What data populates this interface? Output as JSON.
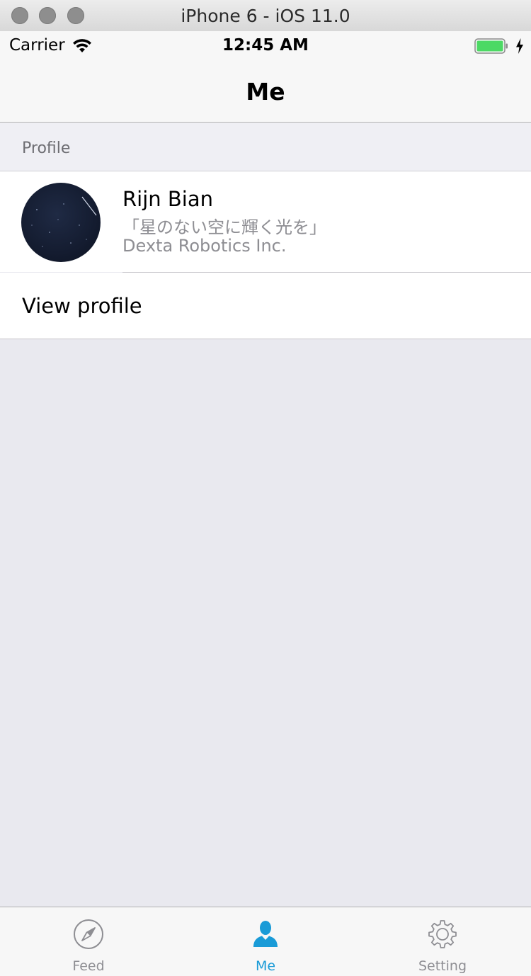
{
  "simulator": {
    "title": "iPhone 6 - iOS 11.0"
  },
  "status_bar": {
    "carrier": "Carrier",
    "time": "12:45 AM",
    "battery_color": "#4cd964"
  },
  "nav": {
    "title": "Me"
  },
  "profile_section": {
    "header": "Profile",
    "name": "Rijn Bian",
    "motto": "「星のない空に輝く光を」",
    "company": "Dexta Robotics Inc.",
    "view_profile_label": "View profile"
  },
  "tabbar": {
    "active_color": "#1a9bd7",
    "items": [
      {
        "label": "Feed",
        "icon": "compass-icon"
      },
      {
        "label": "Me",
        "icon": "person-icon"
      },
      {
        "label": "Setting",
        "icon": "gear-icon"
      }
    ]
  }
}
